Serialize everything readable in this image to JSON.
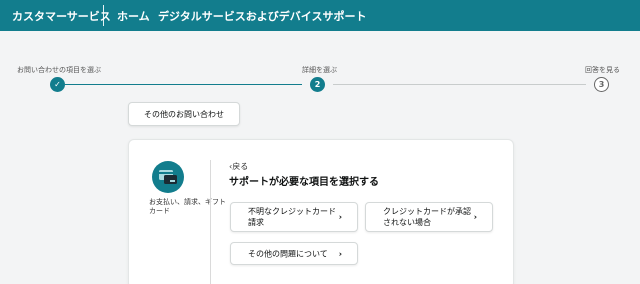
{
  "header": {
    "brand": "カスタマーサービス",
    "nav_home": "ホーム",
    "nav_digital": "デジタルサービスおよびデバイスサポート"
  },
  "stepper": {
    "steps": [
      {
        "label": "お問い合わせの項目を選ぶ",
        "marker": "✓",
        "state": "done"
      },
      {
        "label": "詳細を選ぶ",
        "marker": "2",
        "state": "active"
      },
      {
        "label": "回答を見る",
        "marker": "3",
        "state": "todo"
      }
    ]
  },
  "other_inquiry_label": "その他のお問い合わせ",
  "card": {
    "category_icon": "credit-card-icon",
    "category_label": "お支払い、請求、ギフトカード",
    "back_label": "戻る",
    "title": "サポートが必要な項目を選択する",
    "options": [
      {
        "label": "不明なクレジットカード請求"
      },
      {
        "label": "クレジットカードが承認されない場合"
      },
      {
        "label": "その他の問題について"
      }
    ]
  },
  "colors": {
    "accent": "#127d8d",
    "background": "#f3f4f5"
  }
}
